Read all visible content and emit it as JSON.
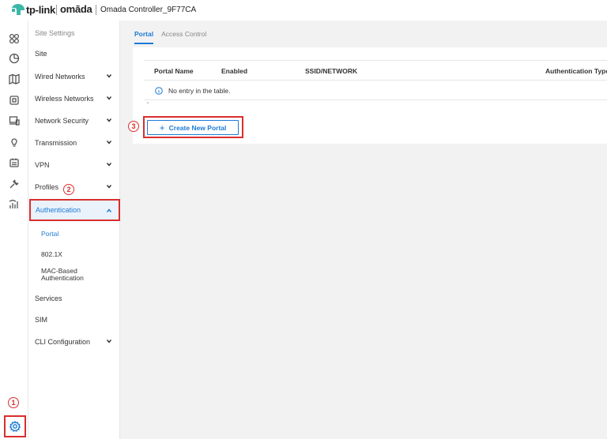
{
  "header": {
    "brand_tplink": "tp-link",
    "brand_omada": "omāda",
    "controller_name": "Omada Controller_9F77CA"
  },
  "rail": {
    "icons": [
      "dashboard-icon",
      "statistics-icon",
      "map-icon",
      "devices-icon",
      "clients-icon",
      "insight-icon",
      "logs-icon",
      "tools-icon",
      "reports-icon",
      "settings-icon"
    ]
  },
  "sidebar": {
    "items": [
      {
        "label": "Site Settings"
      },
      {
        "label": "Site"
      },
      {
        "label": "Wired Networks"
      },
      {
        "label": "Wireless Networks"
      },
      {
        "label": "Network Security"
      },
      {
        "label": "Transmission"
      },
      {
        "label": "VPN"
      },
      {
        "label": "Profiles"
      },
      {
        "label": "Authentication"
      },
      {
        "label": "Services"
      },
      {
        "label": "SIM"
      },
      {
        "label": "CLI Configuration"
      }
    ],
    "sub_items": [
      {
        "label": "Portal"
      },
      {
        "label": "802.1X"
      },
      {
        "label": "MAC-Based"
      },
      {
        "label": "Authentication"
      }
    ]
  },
  "tabs": [
    {
      "label": "Portal"
    },
    {
      "label": "Access Control"
    }
  ],
  "table": {
    "columns": [
      "Portal Name",
      "Enabled",
      "SSID/NETWORK",
      "Authentication Type"
    ],
    "empty_text": "No entry in the table.",
    "arrow": "‹"
  },
  "create_button": {
    "label": "Create New Portal",
    "plus": "+"
  },
  "steps": {
    "one": "1",
    "two": "2",
    "three": "3"
  },
  "colors": {
    "accent": "#1d7bd6",
    "highlight": "#d92e2e"
  }
}
